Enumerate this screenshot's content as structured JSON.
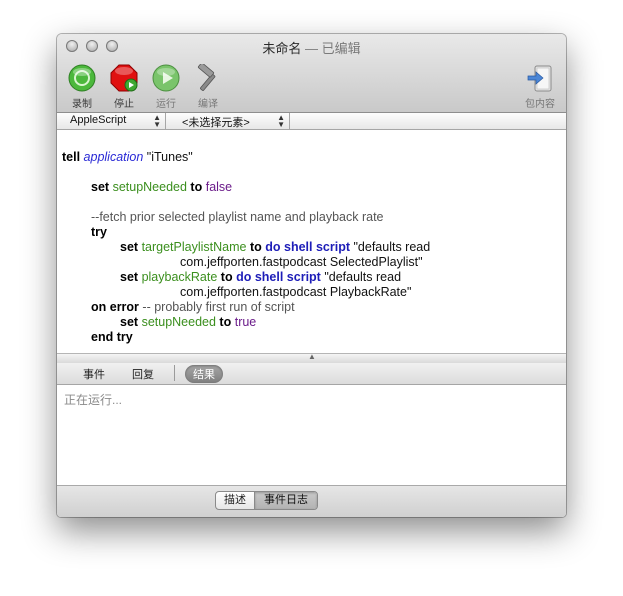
{
  "window": {
    "title": "未命名",
    "title_separator": " — ",
    "title_status": "已编辑"
  },
  "toolbar": {
    "record_label": "录制",
    "stop_label": "停止",
    "run_label": "运行",
    "compile_label": "编译",
    "bundle_label": "包内容"
  },
  "popups": {
    "language": "AppleScript",
    "element": "<未选择元素>"
  },
  "script": {
    "l1_kw": "tell",
    "l1_app": "application",
    "l1_str": " \"iTunes\"",
    "l2_kw": "set",
    "l2_var": "setupNeeded",
    "l2_to": "to",
    "l2_val": "false",
    "l3_cmt": "--fetch prior selected playlist name and playback rate",
    "l4_kw": "try",
    "l5_set": "set",
    "l5_var": "targetPlaylistName",
    "l5_to": "to",
    "l5_cmd": "do shell script",
    "l5_str": " \"defaults read",
    "l6_str": "com.jeffporten.fastpodcast SelectedPlaylist\"",
    "l7_set": "set",
    "l7_var": "playbackRate",
    "l7_to": "to",
    "l7_cmd": "do shell script",
    "l7_str": " \"defaults read",
    "l8_str": "com.jeffporten.fastpodcast PlaybackRate\"",
    "l9_kw": "on error",
    "l9_cmt": " -- probably first run of script",
    "l10_set": "set",
    "l10_var": "setupNeeded",
    "l10_to": "to",
    "l10_val": "true",
    "l11_kw": "end try"
  },
  "tabs": {
    "events": "事件",
    "replies": "回复",
    "result": "结果"
  },
  "result_pane": {
    "text": "正在运行..."
  },
  "bottom": {
    "description": "描述",
    "event_log": "事件日志"
  },
  "colors": {
    "keyword": "#000000",
    "application": "#2a2ad6",
    "variable": "#3b8f1e",
    "command": "#1d1db8",
    "boolean": "#6b1c8a",
    "comment": "#555555",
    "record_button": "#4cb83c",
    "stop_button": "#e01010",
    "run_button": "#7ac46b"
  }
}
